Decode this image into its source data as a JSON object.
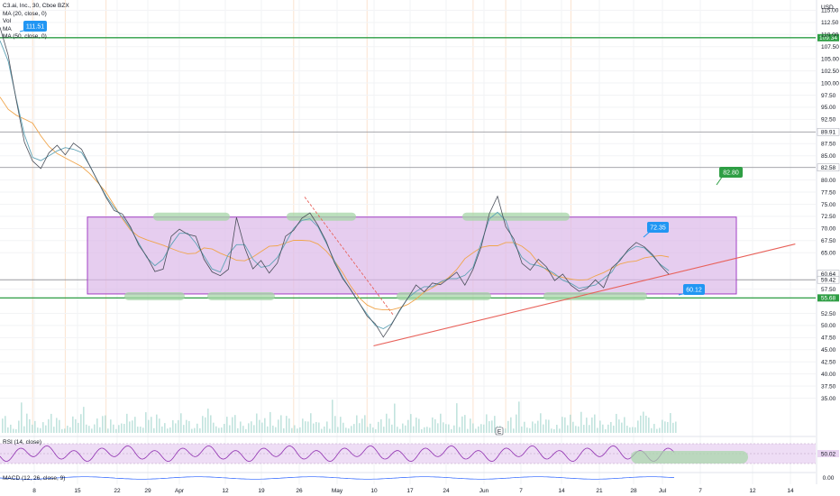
{
  "legend": {
    "title": "C3.ai, Inc., 30, Cboe BZX",
    "ma20": "MA (20, close, 0)",
    "vol": "Vol",
    "ma_partial": "MA",
    "ma50": "MA (50, close, 0)"
  },
  "currency": "USD",
  "rsi_label": "RSI (14, close)",
  "macd_label": "MACD (12, 26, close, 9)",
  "callouts": {
    "top_left": "111.51",
    "target": "82.80",
    "range_top": "72.35",
    "current": "60.12"
  },
  "markers": {
    "earnings": "E"
  },
  "colors": {
    "green_line": "#2e9e44",
    "gray_line": "#9a9aa0",
    "box_fill": "#dcb8e8",
    "box_stroke": "#a23fc4",
    "trendline": "#e8615a",
    "callout_blue": "#2196f3",
    "callout_green": "#2e9e44",
    "ma_fast": "#5fa3b6",
    "ma_slow": "#f0a54c",
    "price": "#4a4f5a",
    "rsi": "#8f2fb0",
    "highlight_green": "#a5d6a7"
  },
  "chart_data": {
    "type": "line",
    "title": "C3.ai, Inc., 30, Cboe BZX",
    "y_axis": {
      "unit": "USD",
      "ticks": [
        115.0,
        112.5,
        110.0,
        107.5,
        105.0,
        102.5,
        100.0,
        97.5,
        95.0,
        92.5,
        87.5,
        85.0,
        80.0,
        77.5,
        75.0,
        72.5,
        70.0,
        67.5,
        65.0,
        57.5,
        52.5,
        50.0,
        47.5,
        45.0,
        42.5,
        40.0,
        37.5,
        35.0
      ],
      "range": [
        32.5,
        116
      ]
    },
    "x_axis": {
      "ticks": [
        "8",
        "15",
        "22",
        "29",
        "Apr",
        "12",
        "19",
        "26",
        "May",
        "10",
        "17",
        "24",
        "Jun",
        "7",
        "14",
        "21",
        "28",
        "Jul",
        "7",
        "12",
        "14"
      ]
    },
    "levels": [
      {
        "label": "109.34",
        "value": 109.34,
        "style": "green"
      },
      {
        "label": "89.91",
        "value": 89.91,
        "style": "gray"
      },
      {
        "label": "82.58",
        "value": 82.58,
        "style": "gray"
      },
      {
        "label": "60.64",
        "value": 60.64,
        "style": "current"
      },
      {
        "label": "59.42",
        "value": 59.42,
        "style": "gray"
      },
      {
        "label": "55.68",
        "value": 55.68,
        "style": "green"
      }
    ],
    "range_box": {
      "top": 72.35,
      "bottom": 56.5
    },
    "trendline": {
      "start": [
        0.458,
        45.8
      ],
      "end": [
        0.975,
        66.8
      ]
    },
    "price_series": [
      [
        0.0,
        111.5
      ],
      [
        0.01,
        106
      ],
      [
        0.02,
        96
      ],
      [
        0.03,
        88
      ],
      [
        0.04,
        84
      ],
      [
        0.05,
        82
      ],
      [
        0.06,
        86
      ],
      [
        0.07,
        87
      ],
      [
        0.08,
        85
      ],
      [
        0.09,
        88
      ],
      [
        0.1,
        86
      ],
      [
        0.11,
        83
      ],
      [
        0.12,
        80
      ],
      [
        0.13,
        76
      ],
      [
        0.14,
        74
      ],
      [
        0.15,
        73
      ],
      [
        0.16,
        70
      ],
      [
        0.17,
        67
      ],
      [
        0.18,
        64
      ],
      [
        0.19,
        61
      ],
      [
        0.2,
        62
      ],
      [
        0.21,
        68
      ],
      [
        0.22,
        70
      ],
      [
        0.23,
        69
      ],
      [
        0.24,
        68
      ],
      [
        0.25,
        64
      ],
      [
        0.26,
        61
      ],
      [
        0.27,
        60
      ],
      [
        0.28,
        62
      ],
      [
        0.29,
        72
      ],
      [
        0.3,
        66
      ],
      [
        0.31,
        62
      ],
      [
        0.32,
        63
      ],
      [
        0.33,
        61
      ],
      [
        0.34,
        63
      ],
      [
        0.35,
        68
      ],
      [
        0.36,
        70
      ],
      [
        0.37,
        72
      ],
      [
        0.38,
        73
      ],
      [
        0.39,
        71
      ],
      [
        0.4,
        67
      ],
      [
        0.41,
        63
      ],
      [
        0.42,
        60
      ],
      [
        0.43,
        57
      ],
      [
        0.44,
        55
      ],
      [
        0.45,
        52
      ],
      [
        0.46,
        50
      ],
      [
        0.47,
        48
      ],
      [
        0.48,
        50
      ],
      [
        0.49,
        53
      ],
      [
        0.5,
        56
      ],
      [
        0.51,
        58
      ],
      [
        0.52,
        57
      ],
      [
        0.53,
        59
      ],
      [
        0.54,
        58
      ],
      [
        0.55,
        60
      ],
      [
        0.56,
        61
      ],
      [
        0.57,
        58
      ],
      [
        0.58,
        62
      ],
      [
        0.59,
        66
      ],
      [
        0.6,
        73
      ],
      [
        0.61,
        77
      ],
      [
        0.62,
        70
      ],
      [
        0.63,
        68
      ],
      [
        0.64,
        63
      ],
      [
        0.65,
        61
      ],
      [
        0.66,
        64
      ],
      [
        0.67,
        62
      ],
      [
        0.68,
        59
      ],
      [
        0.69,
        61
      ],
      [
        0.7,
        58
      ],
      [
        0.71,
        57
      ],
      [
        0.72,
        58
      ],
      [
        0.73,
        59
      ],
      [
        0.74,
        58
      ],
      [
        0.75,
        62
      ],
      [
        0.76,
        63
      ],
      [
        0.77,
        66
      ],
      [
        0.78,
        67
      ],
      [
        0.79,
        66
      ],
      [
        0.8,
        65
      ],
      [
        0.81,
        62
      ],
      [
        0.82,
        60.6
      ]
    ],
    "rsi": {
      "label": "RSI (14, close)",
      "levels": [
        70,
        50,
        30
      ],
      "current": "50.02"
    },
    "macd": {
      "label": "MACD (12, 26, close, 9)",
      "current": "0.00"
    }
  }
}
